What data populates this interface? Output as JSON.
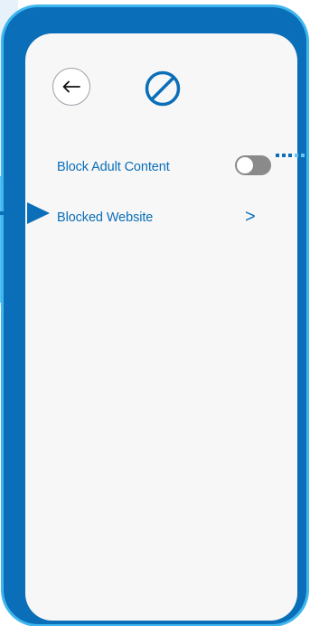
{
  "header": {
    "back_icon": "arrow-left-icon",
    "title_icon": "block-icon"
  },
  "settings": {
    "rows": [
      {
        "label": "Block Adult Content",
        "control": "toggle",
        "toggle_on": false
      },
      {
        "label": "Blocked Website",
        "control": "chevron",
        "chevron": ">"
      }
    ]
  },
  "colors": {
    "accent": "#0a6eb8",
    "frame_border": "#3fb6ee",
    "screen_bg": "#f7f7f7",
    "toggle_off": "#8a8a8a"
  }
}
